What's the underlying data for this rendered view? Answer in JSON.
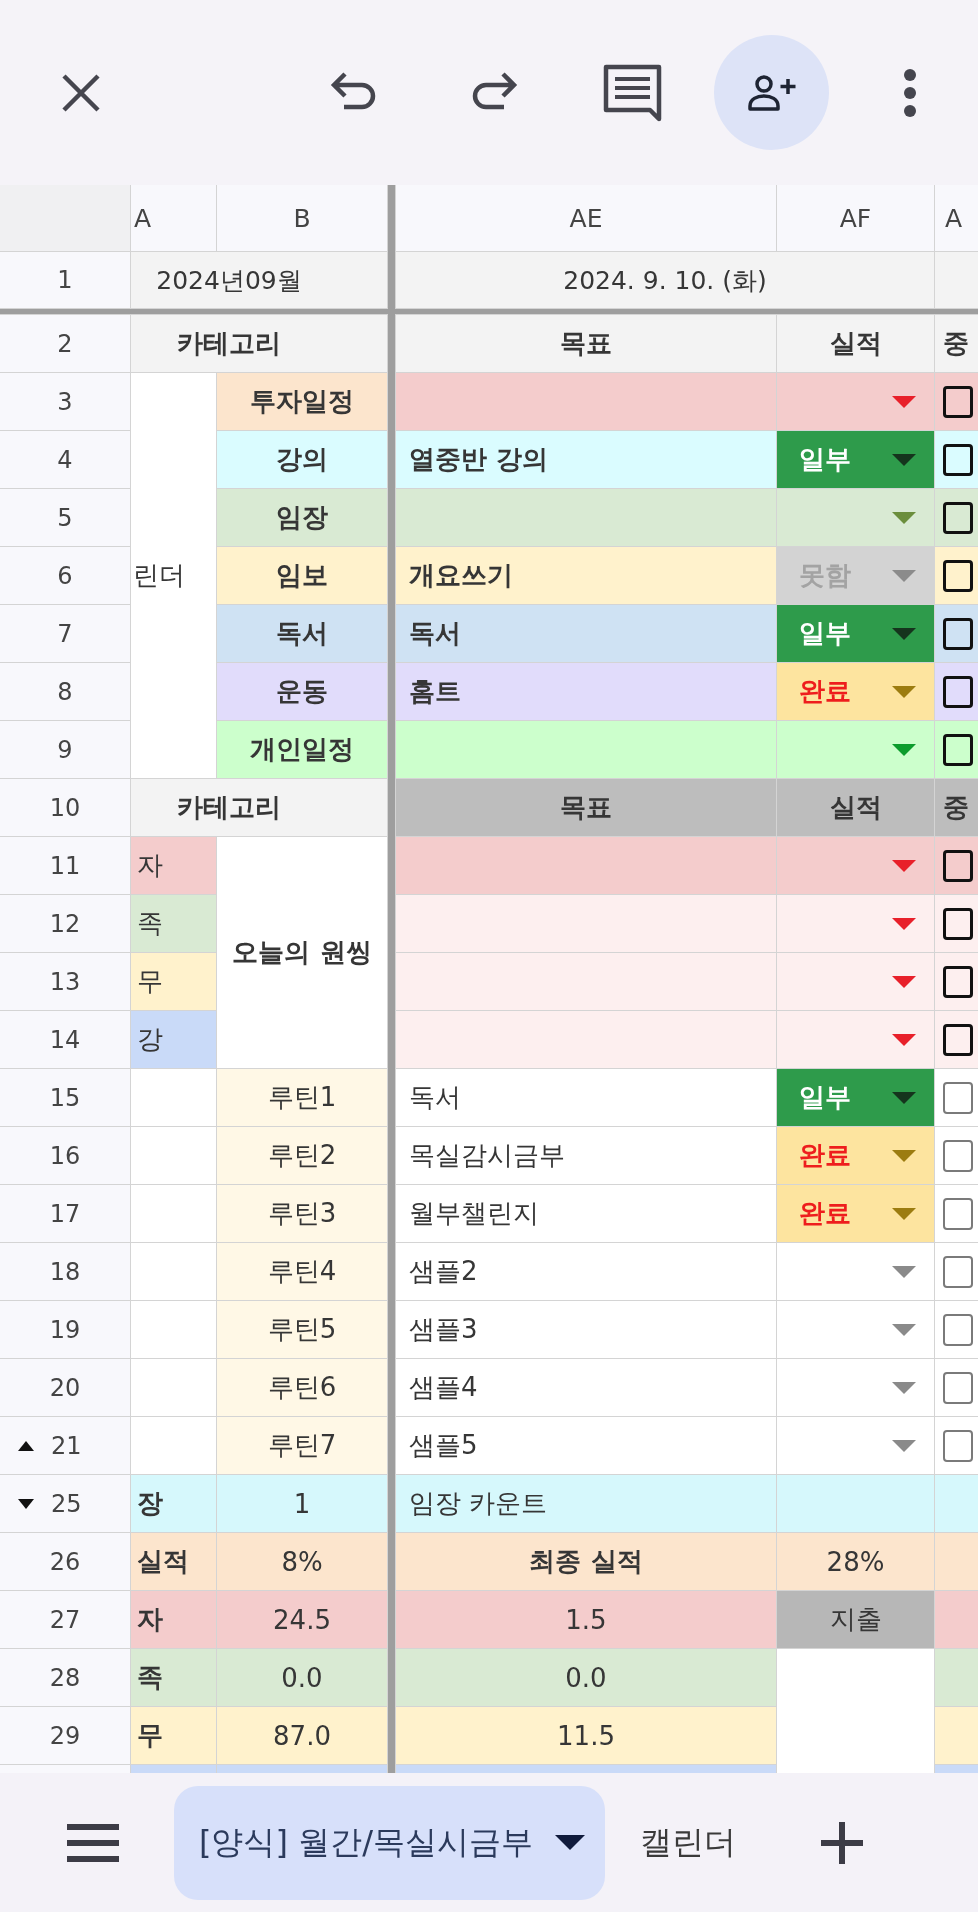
{
  "columns": [
    {
      "label": "A"
    },
    {
      "label": "B"
    },
    {
      "label": "AE"
    },
    {
      "label": "AF"
    },
    {
      "label": "A"
    }
  ],
  "title_row": {
    "number": "1",
    "month": "2024년09월",
    "date": "2024. 9. 10. (화)"
  },
  "plan": {
    "header": {
      "number": "2",
      "kind": "plain",
      "category": "카테고리",
      "goal": "목표",
      "result": "실적",
      "extra": "중"
    },
    "group_label": "린더",
    "rows": [
      {
        "number": "3",
        "category": {
          "label": "투자일정",
          "color": "#fce5cd"
        },
        "color": "#f4cccc",
        "result": {
          "kind": "empty",
          "color": "#e8202a"
        },
        "checked": false
      },
      {
        "number": "4",
        "category": {
          "label": "강의",
          "color": "#dafcff"
        },
        "color": "#dafcff",
        "goal": "열중반 강의",
        "result": {
          "kind": "partial",
          "value": "일부"
        },
        "checked": false
      },
      {
        "number": "5",
        "category": {
          "label": "임장",
          "color": "#d9ead3"
        },
        "color": "#d9ead3",
        "result": {
          "kind": "empty",
          "color": "#6b8e3c"
        },
        "checked": false
      },
      {
        "number": "6",
        "category": {
          "label": "임보",
          "color": "#fff2cc"
        },
        "color": "#fff2cc",
        "goal": "개요쓰기",
        "result": {
          "kind": "missed",
          "value": "못함"
        },
        "checked": false
      },
      {
        "number": "7",
        "category": {
          "label": "독서",
          "color": "#cfe2f3"
        },
        "color": "#cfe2f3",
        "goal": "독서",
        "result": {
          "kind": "partial",
          "value": "일부"
        },
        "checked": false
      },
      {
        "number": "8",
        "category": {
          "label": "운동",
          "color": "#e1dcfb"
        },
        "color": "#e1dcfb",
        "goal": "홈트",
        "result": {
          "kind": "done",
          "value": "완료"
        },
        "checked": false
      },
      {
        "number": "9",
        "category": {
          "label": "개인일정",
          "color": "#ccffcc"
        },
        "color": "#ccffcc",
        "result": {
          "kind": "empty",
          "color": "#0c9c2c"
        },
        "checked": false
      }
    ]
  },
  "one_thing": {
    "header": {
      "number": "10",
      "kind": "shaded",
      "category": "카테고리",
      "goal": "목표",
      "result": "실적",
      "extra": "중"
    },
    "label": "오늘의 원씽",
    "rows": [
      {
        "number": "11",
        "category": {
          "label": "자",
          "color": "#f4cccc"
        },
        "color": "#f4cccc",
        "result": {
          "kind": "empty",
          "color": "#e8202a"
        },
        "checked": false
      },
      {
        "number": "12",
        "category": {
          "label": "족",
          "color": "#d9ead3"
        },
        "color": "#fdefef",
        "result": {
          "kind": "empty",
          "color": "#e8202a"
        },
        "checked": false
      },
      {
        "number": "13",
        "category": {
          "label": "무",
          "color": "#fff2cc"
        },
        "color": "#fdefef",
        "result": {
          "kind": "empty",
          "color": "#e8202a"
        },
        "checked": false
      },
      {
        "number": "14",
        "category": {
          "label": "강",
          "color": "#c9daf8"
        },
        "color": "#fdefef",
        "result": {
          "kind": "empty",
          "color": "#e8202a"
        },
        "checked": false
      }
    ]
  },
  "routines": {
    "rows": [
      {
        "number": "15",
        "name": "루틴1",
        "goal": "독서",
        "result": {
          "kind": "partial",
          "value": "일부"
        },
        "checked": false
      },
      {
        "number": "16",
        "name": "루틴2",
        "goal": "목실감시금부",
        "result": {
          "kind": "done",
          "value": "완료"
        },
        "checked": false
      },
      {
        "number": "17",
        "name": "루틴3",
        "goal": "월부챌린지",
        "result": {
          "kind": "done",
          "value": "완료"
        },
        "checked": false
      },
      {
        "number": "18",
        "name": "루틴4",
        "goal": "샘플2",
        "result": {
          "kind": "empty",
          "color": "#8a8a8a"
        },
        "checked": false
      },
      {
        "number": "19",
        "name": "루틴5",
        "goal": "샘플3",
        "result": {
          "kind": "empty",
          "color": "#8a8a8a"
        },
        "checked": false
      },
      {
        "number": "20",
        "name": "루틴6",
        "goal": "샘플4",
        "result": {
          "kind": "empty",
          "color": "#8a8a8a"
        },
        "checked": false
      },
      {
        "number": "21",
        "name": "루틴7",
        "goal": "샘플5",
        "result": {
          "kind": "empty",
          "color": "#8a8a8a"
        },
        "checked": false
      }
    ]
  },
  "summary": {
    "rows_hidden_before": true,
    "rows": [
      {
        "number": "25",
        "kind": "count",
        "label": "장",
        "value": "1",
        "goal": "임장 카운트",
        "color": "#d6f8fc"
      },
      {
        "number": "26",
        "kind": "total",
        "label": "실적",
        "value": "8%",
        "goal": "최종 실적",
        "result": "28%",
        "color": "#fce5cd"
      },
      {
        "number": "27",
        "kind": "amount",
        "label": "자",
        "value": "24.5",
        "goal": "1.5",
        "note": "지출",
        "color": "#f4cccc"
      },
      {
        "number": "28",
        "kind": "amount",
        "label": "족",
        "value": "0.0",
        "goal": "0.0",
        "color": "#d9ead3"
      },
      {
        "number": "29",
        "kind": "amount",
        "label": "무",
        "value": "87.0",
        "goal": "11.5",
        "color": "#fff2cc"
      },
      {
        "kind": "amount",
        "color": "#c9daf8"
      }
    ]
  },
  "tabs": [
    {
      "label": "[양식] 월간/목실시금부",
      "selected": true
    },
    {
      "label": "캘린더",
      "selected": false
    }
  ]
}
